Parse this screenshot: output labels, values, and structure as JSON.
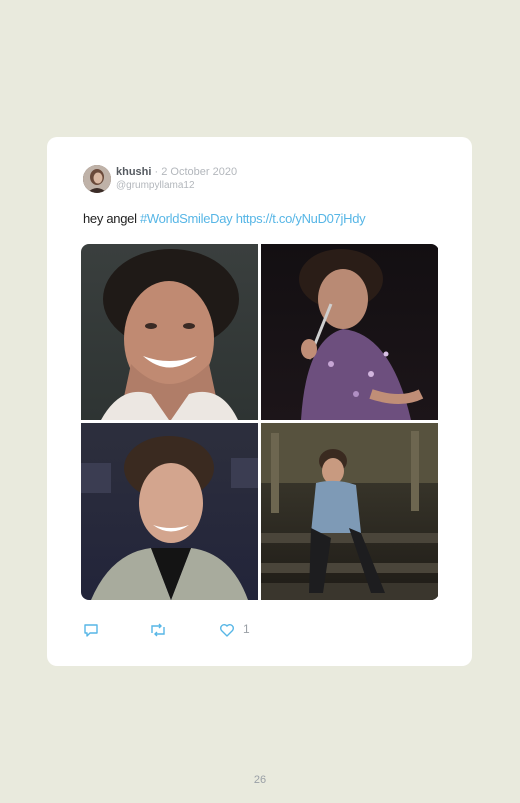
{
  "tweet": {
    "display_name": "khushi",
    "separator": "·",
    "date": "2 October 2020",
    "handle": "@grumpyllama12",
    "text_plain": "hey angel ",
    "hashtag": "#WorldSmileDay",
    "link": "https://t.co/yNuD07jHdy",
    "like_count": "1"
  },
  "icons": {
    "reply": "reply-icon",
    "retweet": "retweet-icon",
    "like": "heart-icon"
  },
  "colors": {
    "page_background": "#e9eadd",
    "card_background": "#ffffff",
    "link": "#57b6e6"
  },
  "page": {
    "number": "26"
  }
}
